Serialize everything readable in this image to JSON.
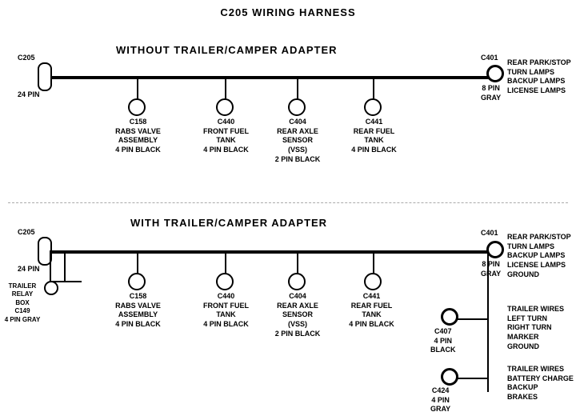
{
  "page": {
    "title": "C205 WIRING HARNESS"
  },
  "section1": {
    "title": "WITHOUT TRAILER/CAMPER ADAPTER",
    "connectors": [
      {
        "id": "C205_1",
        "label": "C205\n\n24 PIN",
        "type": "rect"
      },
      {
        "id": "C401_1",
        "label": "C401",
        "type": "large-circle"
      },
      {
        "id": "C401_1_label",
        "label": "REAR PARK/STOP\nTURN LAMPS\nBACKUP LAMPS\nLICENSE LAMPS",
        "type": "text"
      },
      {
        "id": "C401_1_pin",
        "label": "8 PIN\nGRAY",
        "type": "text"
      },
      {
        "id": "C158_1",
        "label": "C158\nRABS VALVE\nASSEMBLY\n4 PIN BLACK"
      },
      {
        "id": "C440_1",
        "label": "C440\nFRONT FUEL\nTANK\n4 PIN BLACK"
      },
      {
        "id": "C404_1",
        "label": "C404\nREAR AXLE\nSENSOR\n(VSS)\n2 PIN BLACK"
      },
      {
        "id": "C441_1",
        "label": "C441\nREAR FUEL\nTANK\n4 PIN BLACK"
      }
    ]
  },
  "section2": {
    "title": "WITH TRAILER/CAMPER ADAPTER",
    "connectors": [
      {
        "id": "C205_2",
        "label": "C205\n\n24 PIN",
        "type": "rect"
      },
      {
        "id": "C401_2",
        "label": "C401",
        "type": "large-circle"
      },
      {
        "id": "C401_2_label",
        "label": "REAR PARK/STOP\nTURN LAMPS\nBACKUP LAMPS\nLICENSE LAMPS\nGROUND",
        "type": "text"
      },
      {
        "id": "C401_2_pin",
        "label": "8 PIN\nGRAY",
        "type": "text"
      },
      {
        "id": "C158_2",
        "label": "C158\nRABS VALVE\nASSEMBLY\n4 PIN BLACK"
      },
      {
        "id": "C440_2",
        "label": "C440\nFRONT FUEL\nTANK\n4 PIN BLACK"
      },
      {
        "id": "C404_2",
        "label": "C404\nREAR AXLE\nSENSOR\n(VSS)\n2 PIN BLACK"
      },
      {
        "id": "C441_2",
        "label": "C441\nREAR FUEL\nTANK\n4 PIN BLACK"
      },
      {
        "id": "C149",
        "label": "TRAILER\nRELAY\nBOX\nC149\n4 PIN GRAY"
      },
      {
        "id": "C407",
        "label": "C407\n4 PIN\nBLACK"
      },
      {
        "id": "C407_label",
        "label": "TRAILER WIRES\nLEFT TURN\nRIGHT TURN\nMARKER\nGROUND"
      },
      {
        "id": "C424",
        "label": "C424\n4 PIN\nGRAY"
      },
      {
        "id": "C424_label",
        "label": "TRAILER WIRES\nBATTERY CHARGE\nBACKUP\nBRAKES"
      }
    ]
  }
}
